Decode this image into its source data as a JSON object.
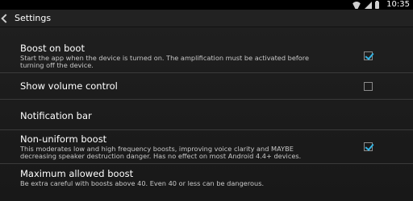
{
  "status_bar": {
    "time": "10:35",
    "icons": [
      "wifi-icon",
      "signal-icon",
      "battery-icon"
    ]
  },
  "action_bar": {
    "title": "Settings"
  },
  "colors": {
    "accent": "#33b5e5",
    "background": "#1b1b1b",
    "divider": "#3a3a3a"
  },
  "preferences": [
    {
      "title": "Boost on boot",
      "summary_lines": [
        "Start the app when the device is turned on. The amplification must be activated before",
        "turning off the device."
      ],
      "checked": true
    },
    {
      "title": "Show volume control",
      "summary_lines": [],
      "checked": false
    },
    {
      "title": "Notification bar",
      "summary_lines": []
    },
    {
      "title": "Non-uniform boost",
      "summary_lines": [
        "This moderates low and high frequency boosts, improving voice clarity and MAYBE",
        "decreasing speaker destruction danger. Has no effect on most Android 4.4+ devices."
      ],
      "checked": true
    },
    {
      "title": "Maximum allowed boost",
      "summary_lines": [
        "Be extra careful with boosts above 40. Even 40 or less can be dangerous."
      ]
    }
  ]
}
